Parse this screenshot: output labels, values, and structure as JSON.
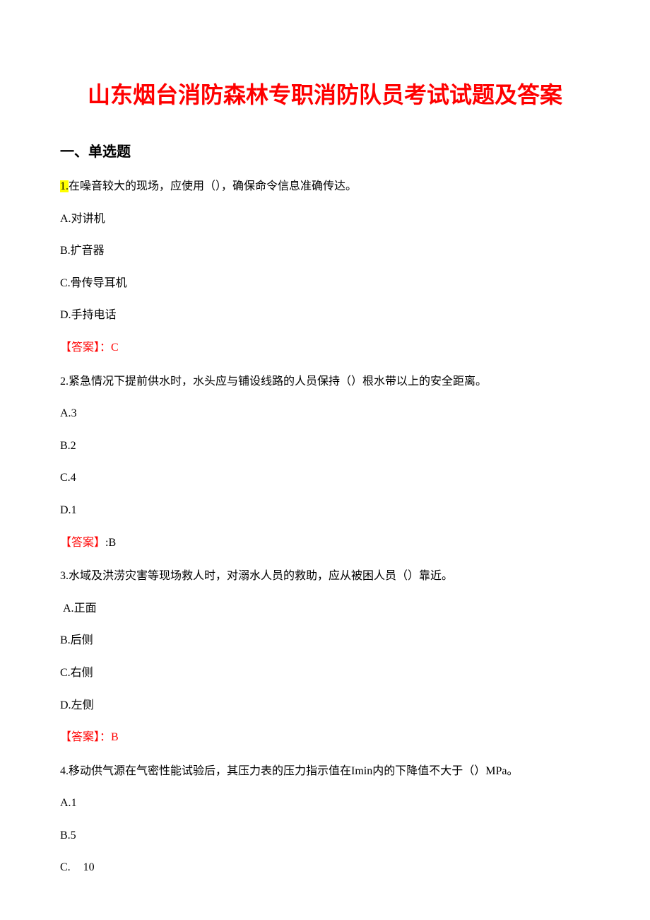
{
  "title": "山东烟台消防森林专职消防队员考试试题及答案",
  "section_header": "一、单选题",
  "questions": [
    {
      "number_highlighted": "1.",
      "stem": "在噪音较大的现场，应使用（），确保命令信息准确传达。",
      "options": {
        "A": "对讲机",
        "B": "扩音器",
        "C": "骨传导耳机",
        "D": "手持电话"
      },
      "answer_label": "【答案】：",
      "answer_value": "C"
    },
    {
      "number": "2.",
      "stem": "紧急情况下提前供水时，水头应与铺设线路的人员保持（）根水带以上的安全距离。",
      "options": {
        "A": "3",
        "B": "2",
        "C": "4",
        "D": "1"
      },
      "answer_label": "【答案】",
      "answer_suffix": ":B"
    },
    {
      "number": "3.",
      "stem": "水域及洪涝灾害等现场救人时，对溺水人员的救助，应从被困人员（）靠近。",
      "options": {
        "A": "正面",
        "B": "后侧",
        "C": "右侧",
        "D": "左侧"
      },
      "answer_label": "【答案】：",
      "answer_value": "B"
    },
    {
      "number": "4.",
      "stem": "移动供气源在气密性能试验后，其压力表的压力指示值在Imin内的下降值不大于（）MPa。",
      "options": {
        "A": "1",
        "B": "5",
        "C": "10"
      }
    }
  ]
}
